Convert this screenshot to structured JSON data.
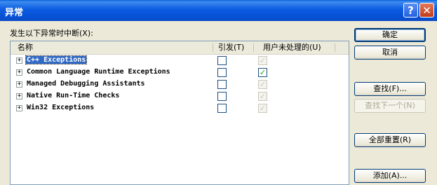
{
  "window": {
    "title": "异常"
  },
  "caption": "发生以下异常时中断(X):",
  "list": {
    "columns": {
      "name": "名称",
      "thrown": "引发(T)",
      "unhandled": "用户未处理的(U)"
    },
    "rows": [
      {
        "name": "C++ Exceptions",
        "thrown": false,
        "unhandled": true,
        "unhandled_enabled": false,
        "selected": true
      },
      {
        "name": "Common Language Runtime Exceptions",
        "thrown": false,
        "unhandled": true,
        "unhandled_enabled": true,
        "selected": false
      },
      {
        "name": "Managed Debugging Assistants",
        "thrown": false,
        "unhandled": true,
        "unhandled_enabled": false,
        "selected": false
      },
      {
        "name": "Native Run-Time Checks",
        "thrown": false,
        "unhandled": true,
        "unhandled_enabled": false,
        "selected": false
      },
      {
        "name": "Win32 Exceptions",
        "thrown": false,
        "unhandled": true,
        "unhandled_enabled": false,
        "selected": false
      }
    ]
  },
  "buttons": {
    "ok": "确定",
    "cancel": "取消",
    "find": "查找(F)...",
    "find_next": "查找下一个(N)",
    "reset_all": "全部重置(R)",
    "add": "添加(A)..."
  },
  "titlebar": {
    "help_glyph": "?",
    "close_glyph": "✕"
  },
  "colors": {
    "titlebar": "#0b5be0",
    "selection": "#316ac5",
    "check": "#21a121"
  }
}
